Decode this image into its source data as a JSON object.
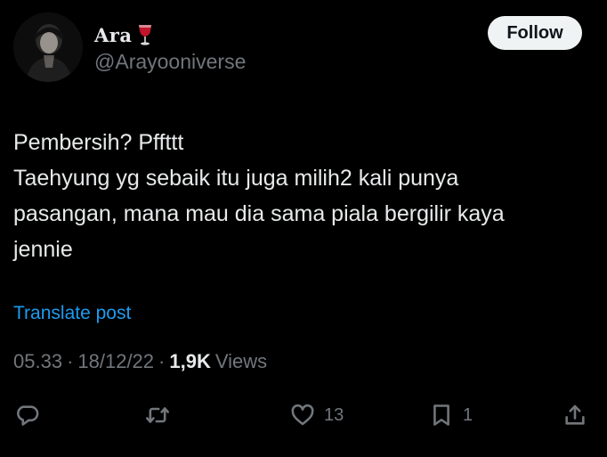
{
  "author": {
    "display_name": "Ara",
    "handle": "@Arayooniverse",
    "name_icon": "wine-glass-icon"
  },
  "follow_button": {
    "label": "Follow"
  },
  "tweet": {
    "lines": [
      "Pembersih? Pffttt",
      "Taehyung yg sebaik itu juga milih2 kali punya",
      "pasangan, mana mau dia sama piala bergilir kaya",
      "jennie"
    ],
    "translate_label": "Translate post"
  },
  "meta": {
    "time": "05.33",
    "separator": "·",
    "date": "18/12/22",
    "views_count": "1,9K",
    "views_label": "Views"
  },
  "actions": {
    "reply": {
      "icon": "reply-icon",
      "count": ""
    },
    "retweet": {
      "icon": "retweet-icon",
      "count": ""
    },
    "like": {
      "icon": "heart-icon",
      "count": "13"
    },
    "bookmark": {
      "icon": "bookmark-icon",
      "count": "1"
    },
    "share": {
      "icon": "share-icon",
      "count": ""
    }
  },
  "colors": {
    "background": "#000000",
    "text_primary": "#e7e9ea",
    "text_secondary": "#71767b",
    "link": "#1d9bf0",
    "follow_bg": "#eff3f4",
    "wine": "#c0152a"
  }
}
